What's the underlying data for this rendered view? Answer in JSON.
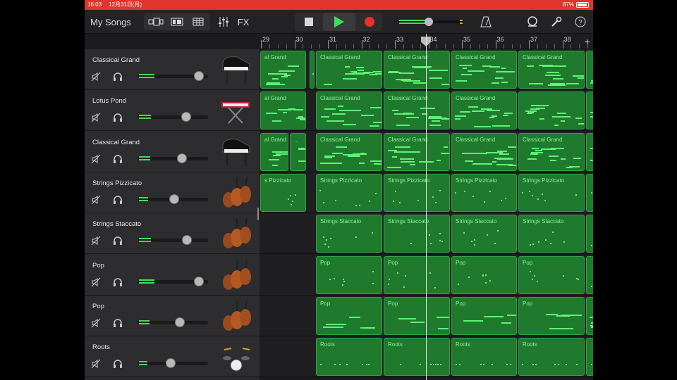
{
  "statusbar": {
    "time": "16:03",
    "date": "12月31日(月)",
    "battery": "87%"
  },
  "toolbar": {
    "my_songs": "My Songs",
    "fx": "FX"
  },
  "ruler": {
    "bars": [
      "29",
      "30",
      "31",
      "32",
      "33",
      "34",
      "35",
      "36",
      "37",
      "38"
    ]
  },
  "tracks": [
    {
      "name": "Classical Grand",
      "instrument": "grand-piano-icon",
      "volume": 0.94
    },
    {
      "name": "Lotus Pond",
      "instrument": "synth-keyboard-icon",
      "volume": 0.74
    },
    {
      "name": "Classical Grand",
      "instrument": "grand-piano-icon",
      "volume": 0.68
    },
    {
      "name": "Strings Pizzicato",
      "instrument": "cello-icon",
      "volume": 0.56
    },
    {
      "name": "Strings Staccato",
      "instrument": "cello-icon",
      "volume": 0.75
    },
    {
      "name": "Pop",
      "instrument": "cello-icon",
      "volume": 0.94
    },
    {
      "name": "Pop",
      "instrument": "cello-icon",
      "volume": 0.64
    },
    {
      "name": "Roots",
      "instrument": "drum-kit-icon",
      "volume": 0.5
    }
  ],
  "lanes": [
    {
      "regions": [
        {
          "label": "al Grand"
        },
        {
          "label": ""
        },
        {
          "label": "Classical Grand"
        },
        {
          "label": "Classical Grand"
        },
        {
          "label": "Classical Grand"
        },
        {
          "label": "Classical Grand"
        }
      ]
    },
    {
      "regions": [
        {
          "label": "al Grand"
        },
        {
          "label": "Classical Grand"
        },
        {
          "label": "Classical Grand"
        },
        {
          "label": "Classical Grand"
        }
      ]
    },
    {
      "regions": [
        {
          "label": "al Grand"
        },
        {
          "label": "..."
        },
        {
          "label": "Classical Grand"
        },
        {
          "label": "Classical Grand"
        },
        {
          "label": "Classical Grand"
        },
        {
          "label": "Classical Grand"
        }
      ]
    },
    {
      "regions": [
        {
          "label": "s Pizzicato"
        },
        {
          "label": "Strings Pizzicato"
        },
        {
          "label": "Strings Pizzicato"
        },
        {
          "label": "Strings Pizzicato"
        },
        {
          "label": "Strings Pizzicato"
        }
      ]
    },
    {
      "regions": [
        {
          "label": "Strings Staccato"
        },
        {
          "label": "Strings Staccato"
        },
        {
          "label": "Strings Staccato"
        },
        {
          "label": "Strings Staccato"
        }
      ]
    },
    {
      "regions": [
        {
          "label": "Pop"
        },
        {
          "label": "Pop"
        },
        {
          "label": "Pop"
        },
        {
          "label": "Pop"
        }
      ]
    },
    {
      "regions": [
        {
          "label": "Pop"
        },
        {
          "label": "Pop"
        },
        {
          "label": "Pop"
        },
        {
          "label": "Pop"
        }
      ]
    },
    {
      "regions": [
        {
          "label": "Roots"
        },
        {
          "label": "Roots"
        },
        {
          "label": "Roots"
        },
        {
          "label": "Roots"
        }
      ]
    }
  ],
  "colors": {
    "accent_green": "#3ee05a",
    "region": "#1f7a2e",
    "statusbar": "#e0342c",
    "record": "#e8302c"
  }
}
